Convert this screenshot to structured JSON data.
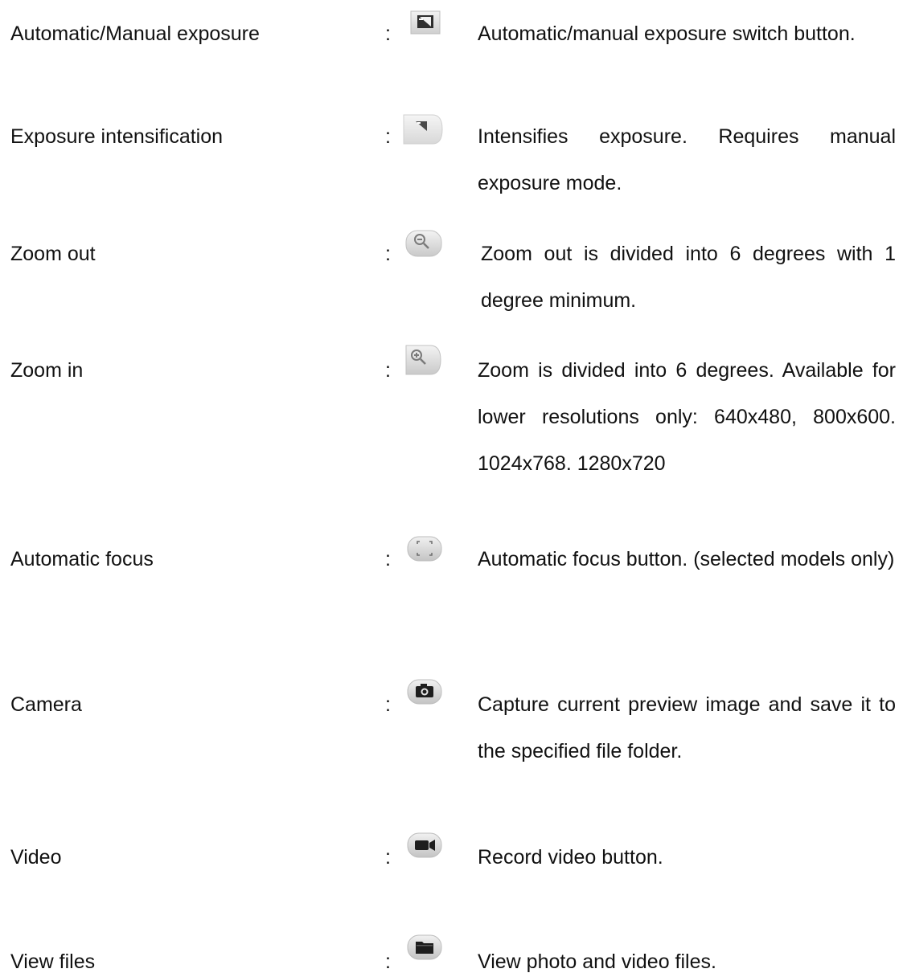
{
  "items": [
    {
      "label": "Automatic/Manual exposure",
      "colon": ":",
      "icon": "exposure-toggle-icon",
      "description": "Automatic/manual exposure switch button."
    },
    {
      "label": "Exposure intensification",
      "colon": ":",
      "icon": "exposure-intensify-icon",
      "description": "Intensifies exposure. Requires manual exposure mode."
    },
    {
      "label": "Zoom out",
      "colon": ":",
      "icon": "zoom-out-icon",
      "description": "Zoom out is divided into 6 degrees with 1 degree minimum."
    },
    {
      "label": "Zoom in",
      "colon": ":",
      "icon": "zoom-in-icon",
      "description": "Zoom is divided into 6 degrees. Available for lower resolutions only: 640x480, 800x600. 1024x768. 1280x720"
    },
    {
      "label": "Automatic focus",
      "colon": ":",
      "icon": "autofocus-icon",
      "description": "Automatic focus button. (selected models only)"
    },
    {
      "label": "Camera",
      "colon": ":",
      "icon": "camera-icon",
      "description": "Capture current preview image and save it to the specified file folder."
    },
    {
      "label": "Video",
      "colon": ":",
      "icon": "video-camera-icon",
      "description": "Record video button."
    },
    {
      "label": "View files",
      "colon": ":",
      "icon": "folder-icon",
      "description": "View photo and video files."
    }
  ]
}
